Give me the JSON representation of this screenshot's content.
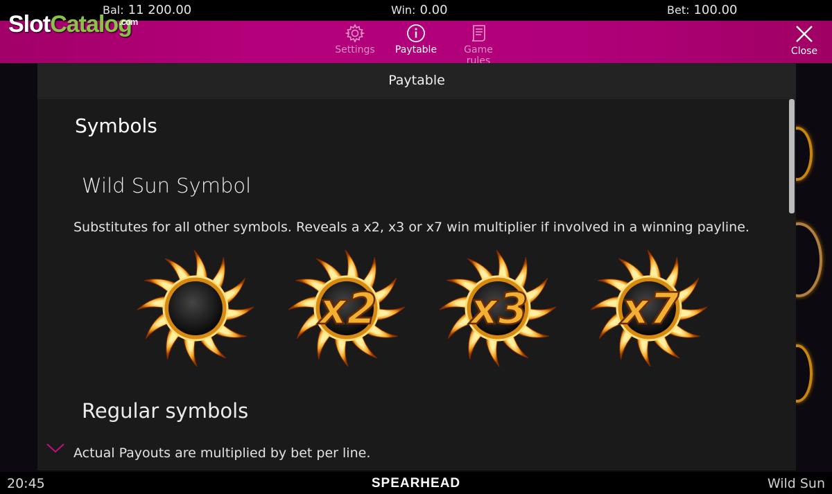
{
  "status": {
    "balance_label": "Bal:",
    "balance_value": "11 200.00",
    "win_label": "Win:",
    "win_value": "0.00",
    "bet_label": "Bet:",
    "bet_value": "100.00"
  },
  "logo": {
    "slot": "Slot",
    "catalog": "Catalog",
    "com": ".com"
  },
  "header": {
    "settings_label": "Settings",
    "paytable_label": "Paytable",
    "rules_label": "Game rules",
    "close_label": "Close"
  },
  "panel": {
    "title": "Paytable",
    "symbols_heading": "Symbols",
    "wild_heading": "Wild Sun Symbol",
    "wild_description": "Substitutes for all other symbols. Reveals a x2, x3 or x7 win multiplier if involved in a winning payline.",
    "multipliers": [
      "",
      "x2",
      "x3",
      "x7"
    ],
    "regular_heading": "Regular symbols",
    "payout_note": "Actual Payouts are multiplied by bet per line."
  },
  "footer": {
    "time": "20:45",
    "brand": "SPEARHEAD",
    "game_name": "Wild Sun"
  },
  "colors": {
    "header_magenta": "#b0007a",
    "sun_gold": "#f0a020",
    "logo_green": "#8bc34a"
  }
}
